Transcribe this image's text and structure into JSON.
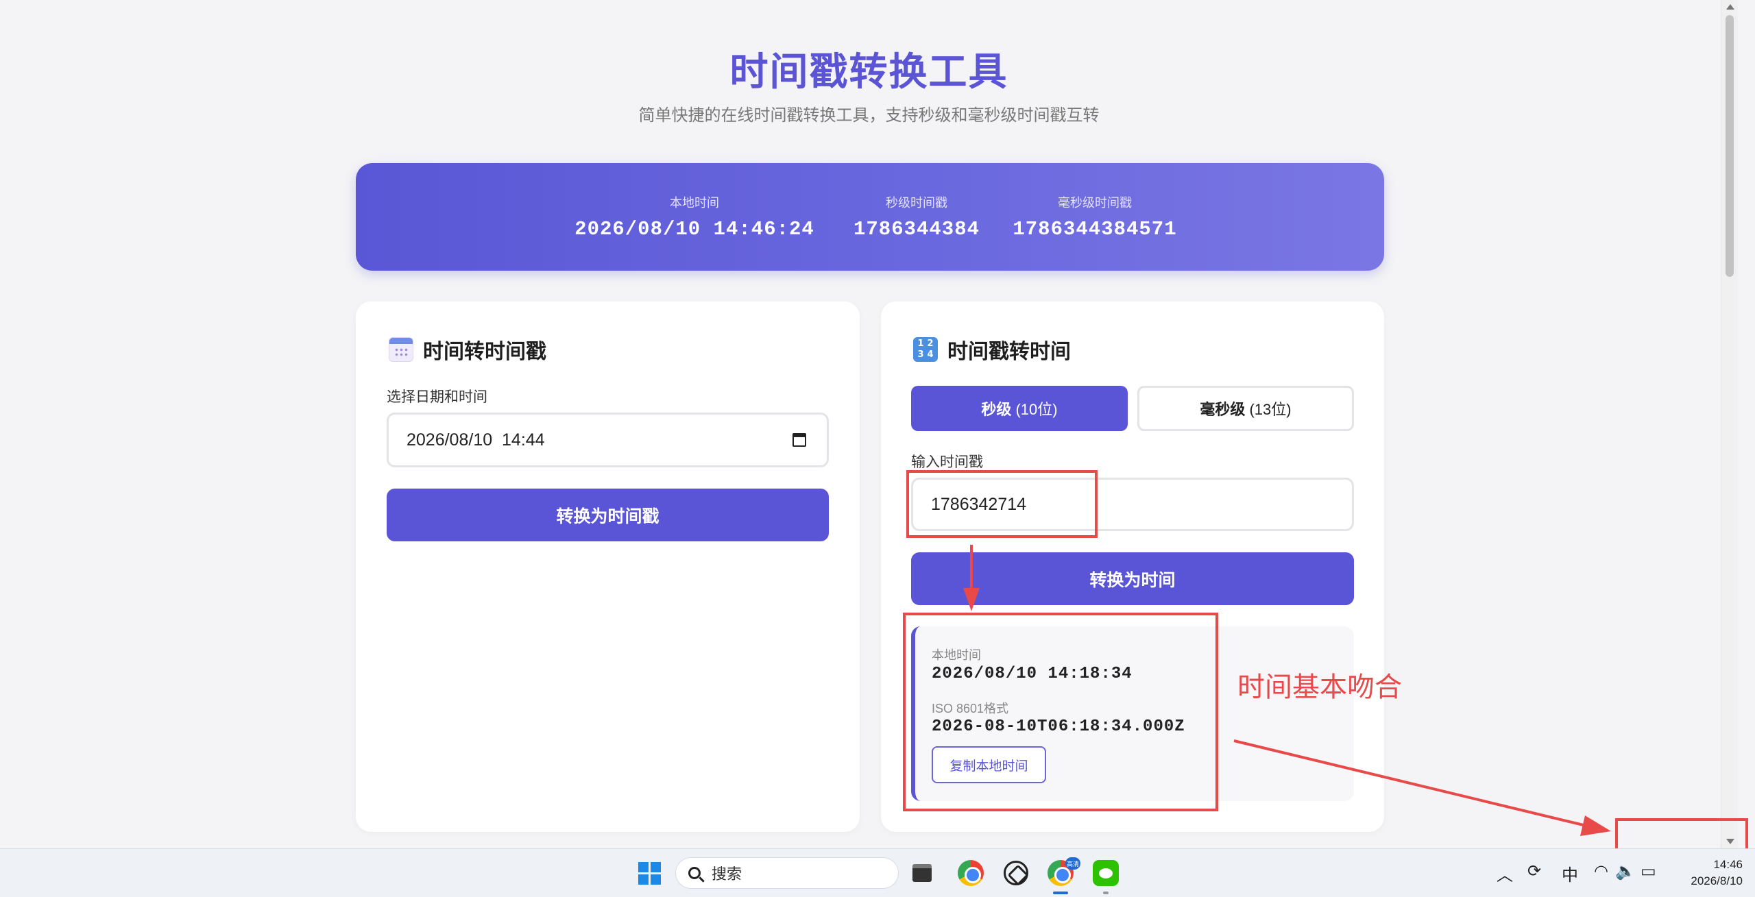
{
  "header": {
    "title": "时间戳转换工具",
    "subtitle": "简单快捷的在线时间戳转换工具，支持秒级和毫秒级时间戳互转"
  },
  "current": {
    "local_label": "本地时间",
    "local_value": "2026/08/10 14:46:24",
    "sec_label": "秒级时间戳",
    "sec_value": "1786344384",
    "ms_label": "毫秒级时间戳",
    "ms_value": "1786344384571"
  },
  "date_to_ts": {
    "title": "时间转时间戳",
    "field_label": "选择日期和时间",
    "date_value": "2026/08/10  14:44",
    "button": "转换为时间戳"
  },
  "ts_to_date": {
    "title": "时间戳转时间",
    "icon_digits": [
      "1",
      "2",
      "3",
      "4"
    ],
    "seg_sec": "秒级",
    "seg_sec_sub": "(10位)",
    "seg_ms": "毫秒级",
    "seg_ms_sub": "(13位)",
    "field_label": "输入时间戳",
    "input_value": "1786342714",
    "button": "转换为时间",
    "result": {
      "local_label": "本地时间",
      "local_value": "2026/08/10 14:18:34",
      "iso_label": "ISO 8601格式",
      "iso_value": "2026-08-10T06:18:34.000Z",
      "copy_button": "复制本地时间"
    }
  },
  "annotation": {
    "text": "时间基本吻合",
    "color": "#e84a4a"
  },
  "taskbar": {
    "search_placeholder": "搜索",
    "chrome_badge": "高清",
    "ime": "中",
    "clock_time": "14:46",
    "clock_date": "2026/8/10"
  },
  "colors": {
    "accent": "#5a55d6",
    "background": "#f4f4f6"
  }
}
